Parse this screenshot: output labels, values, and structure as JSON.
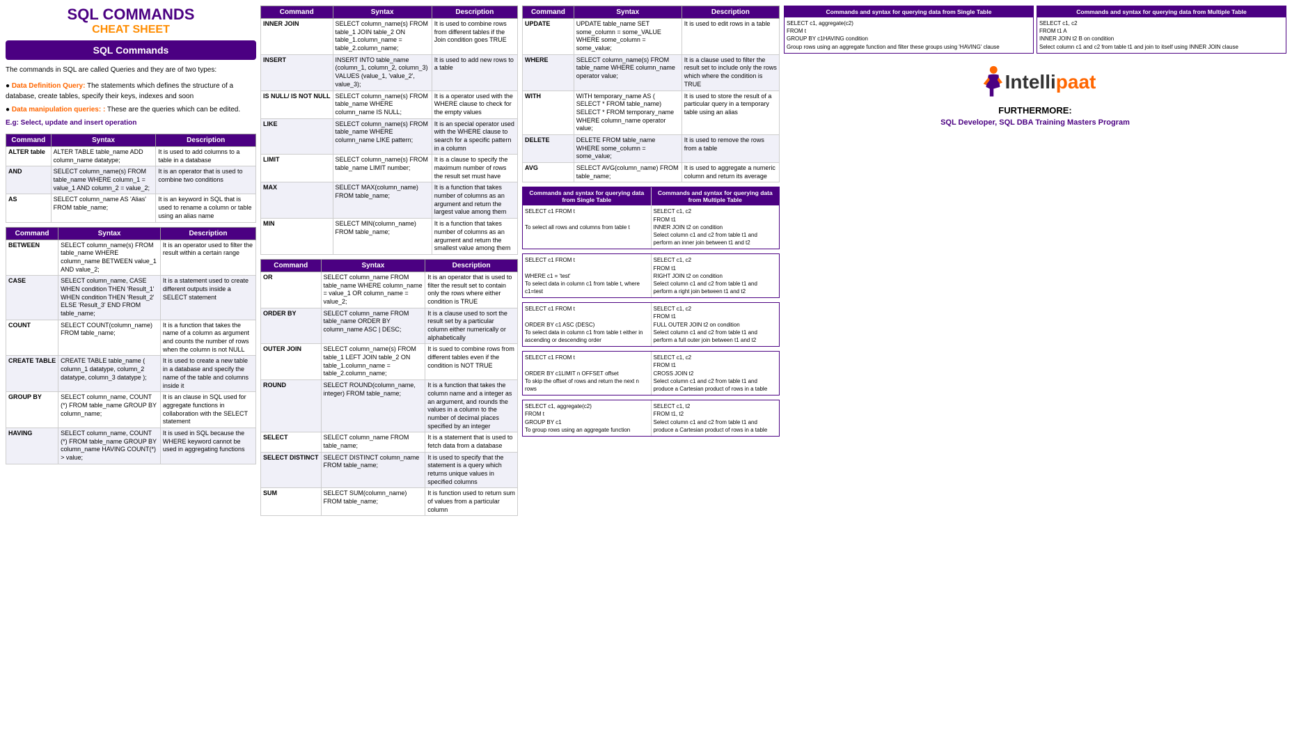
{
  "page": {
    "title": "SQL COMMANDS CHEAT SHEET"
  },
  "left": {
    "main_title": "SQL COMMANDS",
    "sub_title": "CHEAT SHEET",
    "sql_commands_box": "SQL Commands",
    "intro": "The commands in SQL are called Queries and they are of two types:",
    "bullet1_label": "Data Definition Query:",
    "bullet1_text": "The statements which defines the structure of a database, create tables, specify their keys, indexes and soon",
    "bullet2_label": "Data manipulation queries: :",
    "bullet2_text": "These are the queries which can be edited.",
    "eg": "E.g: Select, update and insert operation",
    "table1_headers": [
      "Command",
      "Syntax",
      "Description"
    ],
    "table1_rows": [
      [
        "ALTER table",
        "ALTER TABLE table_name ADD column_name datatype;",
        "It is used to add columns to a table in a database"
      ],
      [
        "AND",
        "SELECT column_name(s) FROM table_name WHERE column_1 = value_1 AND column_2 = value_2;",
        "It is an operator that is used to combine two conditions"
      ],
      [
        "AS",
        "SELECT column_name AS 'Alias' FROM table_name;",
        "It is an keyword in SQL that is used to rename a column or table using an alias name"
      ]
    ],
    "table2_headers": [
      "Command",
      "Syntax",
      "Description"
    ],
    "table2_rows": [
      [
        "BETWEEN",
        "SELECT column_name(s) FROM table_name WHERE column_name BETWEEN value_1 AND value_2;",
        "It is an operator used to filter the result within a certain range"
      ],
      [
        "CASE",
        "SELECT column_name, CASE WHEN condition THEN 'Result_1' WHEN condition THEN 'Result_2' ELSE 'Result_3' END FROM table_name;",
        "It is a statement used to create different outputs inside a SELECT statement"
      ],
      [
        "COUNT",
        "SELECT COUNT(column_name) FROM table_name;",
        "It is a function that takes the name of a column as argument and counts the number of rows when the column is not NULL"
      ],
      [
        "CREATE TABLE",
        "CREATE TABLE table_name ( column_1 datatype, column_2 datatype, column_3 datatype );",
        "It is used to create a new table in a database and specify the name of the table and columns inside it"
      ],
      [
        "GROUP BY",
        "SELECT column_name, COUNT (*) FROM table_name GROUP BY column_name;",
        "It is an clause in SQL used for aggregate functions in collaboration with the SELECT statement"
      ],
      [
        "HAVING",
        "SELECT column_name, COUNT (*) FROM table_name GROUP BY column_name HAVING COUNT(*) > value;",
        "It is used in SQL because the WHERE keyword cannot be used in aggregating functions"
      ]
    ]
  },
  "middle1": {
    "table1_headers": [
      "Command",
      "Syntax",
      "Description"
    ],
    "table1_rows": [
      [
        "INNER JOIN",
        "SELECT column_name(s) FROM table_1 JOIN table_2 ON table_1.column_name = table_2.column_name;",
        "It is used to combine rows from different tables if the Join condition goes TRUE"
      ],
      [
        "INSERT",
        "INSERT INTO table_name (column_1, column_2, column_3) VALUES (value_1, 'value_2', value_3);",
        "It is used to add new rows to a table"
      ],
      [
        "IS NULL/ IS NOT NULL",
        "SELECT column_name(s) FROM table_name WHERE column_name IS NULL;",
        "It is a operator used with the WHERE clause to check for the empty values"
      ],
      [
        "LIKE",
        "SELECT column_name(s) FROM table_name WHERE column_name LIKE pattern;",
        "It is an special operator used with the WHERE clause to search for a specific pattern in a column"
      ],
      [
        "LIMIT",
        "SELECT column_name(s) FROM table_name LIMIT number;",
        "It is a clause to specify the maximum number of rows the result set must have"
      ],
      [
        "MAX",
        "SELECT MAX(column_name) FROM table_name;",
        "It is a function that takes number of columns as an argument and return the largest value among them"
      ],
      [
        "MIN",
        "SELECT MIN(column_name) FROM table_name;",
        "It is a function that takes number of columns as an argument and return the smallest value among them"
      ]
    ],
    "table2_headers": [
      "Command",
      "Syntax",
      "Description"
    ],
    "table2_rows": [
      [
        "OR",
        "SELECT column_name FROM table_name WHERE column_name = value_1 OR column_name = value_2;",
        "It is an operator that is used to filter the result set to contain only the rows where either condition is TRUE"
      ],
      [
        "ORDER BY",
        "SELECT column_name FROM table_name ORDER BY column_name ASC | DESC;",
        "It is a clause used to sort the result set by a particular column either numerically or alphabetically"
      ],
      [
        "OUTER JOIN",
        "SELECT column_name(s) FROM table_1 LEFT JOIN table_2 ON table_1.column_name = table_2.column_name;",
        "It is sued to combine rows from different tables even if the condition is NOT TRUE"
      ],
      [
        "ROUND",
        "SELECT ROUND(column_name, integer) FROM table_name;",
        "It is a function that takes the column name and a integer as an argument, and rounds the values in a column to the number of decimal places specified by an integer"
      ],
      [
        "SELECT",
        "SELECT column_name FROM table_name;",
        "It is a statement that is used to fetch data from a database"
      ],
      [
        "SELECT DISTINCT",
        "SELECT DISTINCT column_name FROM table_name;",
        "It is used to specify that the statement is a query which returns unique values in specified columns"
      ],
      [
        "SUM",
        "SELECT SUM(column_name) FROM table_name;",
        "It is function used to return sum of values from a particular column"
      ]
    ]
  },
  "middle2": {
    "table1_headers": [
      "Command",
      "Syntax",
      "Description"
    ],
    "table1_rows": [
      [
        "UPDATE",
        "UPDATE table_name SET some_column = some_VALUE WHERE some_column = some_value;",
        "It is used to edit rows in a table"
      ],
      [
        "WHERE",
        "SELECT column_name(s) FROM table_name WHERE column_name operator value;",
        "It is a clause used to filter the result set to include only the rows which where the condition is TRUE"
      ],
      [
        "WITH",
        "WITH temporary_name AS ( SELECT * FROM table_name) SELECT * FROM temporary_name WHERE column_name operator value;",
        "It is used to store the result of a particular query in a temporary table using an alias"
      ],
      [
        "DELETE",
        "DELETE FROM table_name WHERE some_column = some_value;",
        "It is used to remove the rows from a table"
      ],
      [
        "AVG",
        "SELECT AVG(column_name) FROM table_name;",
        "It is used to aggregate a numeric column and return its average"
      ]
    ],
    "single_table_header": "Commands and syntax for querying data from Single Table",
    "multiple_table_header": "Commands and syntax for querying data from Multiple Table",
    "query_rows": [
      {
        "single": "SELECT c1 FROM t\n\nTo select all rows and columns from table t",
        "multiple": "SELECT c1, c2\nFROM t1\nINNER JOIN t2 on condition\nSelect column c1 and c2 from table t1 and perform an inner join between t1 and t2"
      },
      {
        "single": "SELECT c1 FROM t\n\nWHERE c1 = 'test'\nTo select data in column c1 from table t, where c1=test",
        "multiple": "SELECT c1, c2\nFROM t1\nRIGHT JOIN t2 on condition\nSelect column c1 and c2 from table t1 and perform a right join between t1 and t2"
      },
      {
        "single": "SELECT c1 FROM t\n\nORDER BY c1 ASC (DESC)\nTo select data in column c1 from table t either in ascending or descending order",
        "multiple": "SELECT c1, c2\nFROM t1\nFULL OUTER JOIN t2 on condition\nSelect column c1 and c2 from table t1 and perform a full outer join between t1 and t2"
      },
      {
        "single": "SELECT c1 FROM t\n\nORDER BY c1LIMIT n OFFSET offset\nTo skip the offset of rows and return the next n rows",
        "multiple": "SELECT c1, c2\nFROM t1\nCROSS JOIN t2\nSelect column c1 and c2 from table t1 and produce a Cartesian product of rows in a table"
      },
      {
        "single": "SELECT c1, aggregate(c2)\nFROM t\nGROUP BY c1\nTo group rows using an aggregate function",
        "multiple": "SELECT c1, t2\nFROM t1, t2\nSelect column c1 and c2 from table t1 and produce a Cartesian product of rows in a table"
      }
    ]
  },
  "right": {
    "top_boxes": [
      {
        "header": "Commands and syntax for querying data from Single Table",
        "content": "SELECT c1, aggregate(c2)\nFROM t\nGROUP BY c1HAVING condition\nGroup rows using an aggregate function and filter these groups using 'HAVING' clause"
      },
      {
        "header": "Commands and syntax for querying data from Multiple Table",
        "content": "SELECT c1, c2\nFROM t1 A\nINNER JOIN t2 B on condition\nSelect column c1 and c2 from table t1 and join to itself using INNER JOIN clause"
      }
    ],
    "furthermore_label": "FURTHERMORE:",
    "furthermore_text": "SQL Developer, SQL DBA Training Masters Program",
    "intellipaat_intelli": "Intelli",
    "intellipaat_paat": "paat"
  }
}
